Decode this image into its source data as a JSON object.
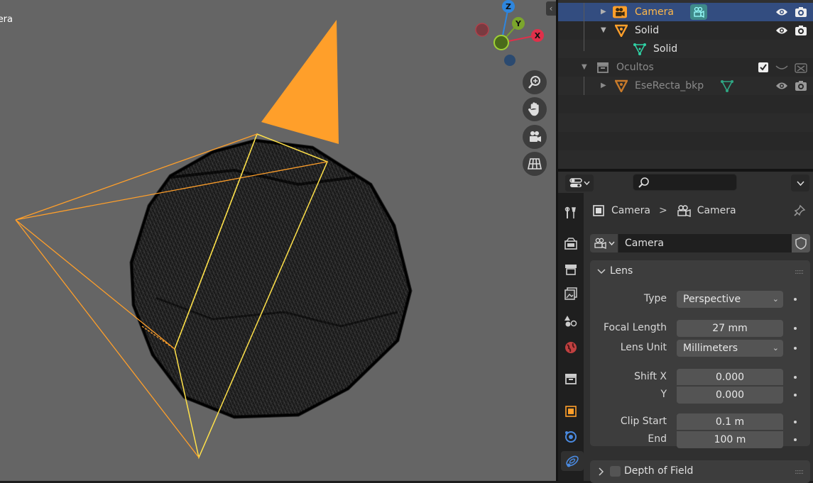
{
  "viewport": {
    "header_label": "era",
    "gizmo": {
      "z_label": "Z",
      "y_label": "Y",
      "x_label": "X"
    },
    "nav_buttons": [
      "zoom-icon",
      "hand-icon",
      "camera-view-icon",
      "grid-ortho-icon"
    ],
    "colors": {
      "background": "#656565",
      "camera": "#ff9f2a",
      "camera_frame_selected": "#ffe14a",
      "mesh": "#000000"
    }
  },
  "outliner": {
    "rows": [
      {
        "label": "Camera",
        "kind": "camera",
        "selected": true,
        "color": "#ff9f2a"
      },
      {
        "label": "Solid",
        "kind": "mesh-object"
      },
      {
        "label": "Solid",
        "kind": "mesh-data"
      },
      {
        "label": "Ocultos",
        "kind": "collection",
        "dimmed": true
      },
      {
        "label": "EseRecta_bkp",
        "kind": "mesh-object",
        "dimmed": true
      }
    ]
  },
  "properties": {
    "breadcrumb": {
      "object": "Camera",
      "data": "Camera"
    },
    "datablock_name": "Camera",
    "lens_panel": {
      "title": "Lens",
      "type_label": "Type",
      "type_value": "Perspective",
      "focal_length_label": "Focal Length",
      "focal_length_value": "27 mm",
      "lens_unit_label": "Lens Unit",
      "lens_unit_value": "Millimeters",
      "shift_x_label": "Shift X",
      "shift_x_value": "0.000",
      "shift_y_label": "Y",
      "shift_y_value": "0.000",
      "clip_start_label": "Clip Start",
      "clip_start_value": "0.1 m",
      "clip_end_label": "End",
      "clip_end_value": "100 m"
    },
    "dof_panel": {
      "title": "Depth of Field"
    }
  }
}
